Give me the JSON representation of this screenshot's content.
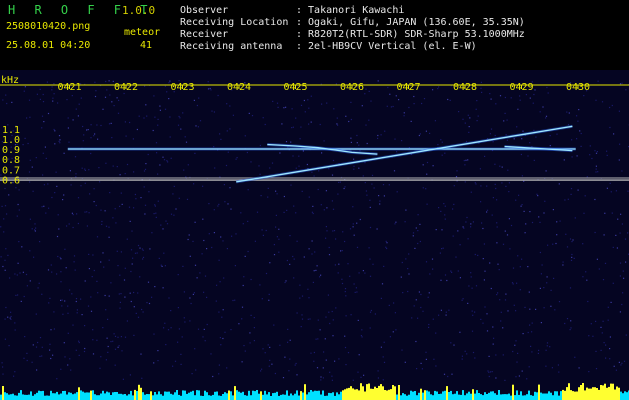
{
  "header": {
    "app_name": "H R O F F T",
    "version": "1.0.0",
    "file_name": "2508010420.png",
    "timestamp": "25.08.01 04:20",
    "meteor_label": "meteor",
    "meteor_count": "41",
    "info": [
      {
        "label": "Observer",
        "value": ": Takanori Kawachi"
      },
      {
        "label": "Receiving Location",
        "value": ": Ogaki, Gifu, JAPAN (136.60E, 35.35N)"
      },
      {
        "label": "Receiver",
        "value": ": R820T2(RTL-SDR) SDR-Sharp 53.1000MHz"
      },
      {
        "label": "Receiving antenna",
        "value": ": 2el-HB9CV Vertical (el. E-W)"
      }
    ]
  },
  "colors": {
    "brand": "#34d04a",
    "text_yellow": "#e8e800",
    "text_white": "#e8e8e8",
    "background": "#000000",
    "noise": "#1a1a6a",
    "signal": "#9fe8ff",
    "level_bars": "#00e0ff",
    "peak_bars": "#ffff30"
  },
  "chart_data": {
    "type": "spectrogram",
    "ylabel": "kHz",
    "x_ticks": [
      "0421",
      "0422",
      "0423",
      "0424",
      "0425",
      "0426",
      "0427",
      "0428",
      "0429",
      "0430"
    ],
    "y_ticks": [
      "1.1",
      "1.0",
      "0.9",
      "0.8",
      "0.7",
      "0.6"
    ],
    "time_range": [
      "04:20",
      "04:30"
    ],
    "freq_range_khz": [
      0.57,
      1.16
    ],
    "reference_lines_khz": [
      0.62,
      0.607,
      0.595
    ],
    "traces": [
      {
        "kind": "carrier",
        "points": [
          [
            0.97,
            0.905
          ],
          [
            9.96,
            0.905
          ]
        ]
      },
      {
        "kind": "sweep",
        "points": [
          [
            3.95,
            0.58
          ],
          [
            9.9,
            1.13
          ]
        ]
      },
      {
        "kind": "curve",
        "points": [
          [
            4.5,
            0.95
          ],
          [
            5.0,
            0.935
          ],
          [
            5.4,
            0.918
          ],
          [
            5.7,
            0.895
          ],
          [
            6.0,
            0.872
          ],
          [
            6.45,
            0.855
          ]
        ]
      },
      {
        "kind": "curve",
        "points": [
          [
            8.7,
            0.93
          ],
          [
            9.3,
            0.91
          ],
          [
            9.9,
            0.89
          ]
        ]
      }
    ]
  }
}
